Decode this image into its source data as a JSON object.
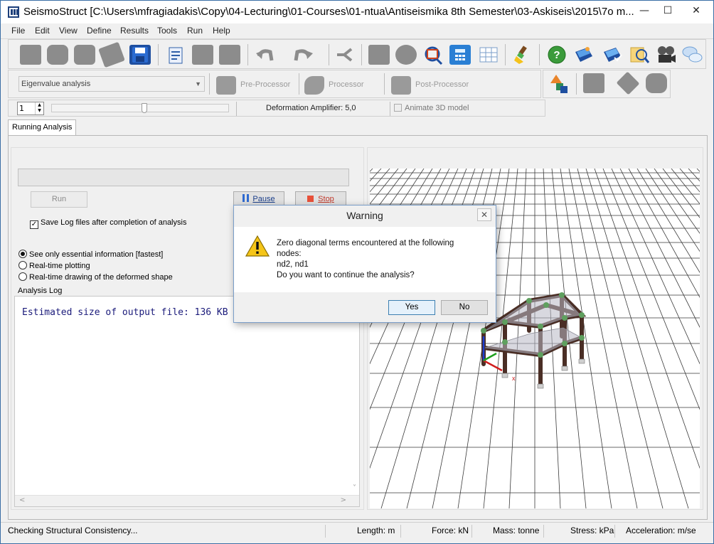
{
  "window": {
    "title": "SeismoStruct   [C:\\Users\\mfragiadakis\\Copy\\04-Lecturing\\01-Courses\\01-ntua\\Antiseismika 8th Semester\\03-Askiseis\\2015\\7o m...",
    "minimize": "—",
    "maximize": "☐",
    "close": "✕"
  },
  "menu": [
    "File",
    "Edit",
    "View",
    "Define",
    "Results",
    "Tools",
    "Run",
    "Help"
  ],
  "toolbar2": {
    "analysis_type": "Eigenvalue analysis",
    "stages": [
      "Pre-Processor",
      "Processor",
      "Post-Processor"
    ]
  },
  "toolbar3": {
    "step_value": "1",
    "deformation_amplifier": "Deformation Amplifier: 5,0",
    "animate_label": "Animate 3D model"
  },
  "tabs": [
    "Running Analysis"
  ],
  "controls": {
    "run": "Run",
    "pause": "Pause",
    "stop": "Stop",
    "save_log": "Save Log files after completion of analysis",
    "radios": [
      "See only essential information [fastest]",
      "Real-time plotting",
      "Real-time drawing of the deformed shape"
    ]
  },
  "log": {
    "label": "Analysis Log",
    "text": "Estimated size of output file: 136 KB"
  },
  "dialog": {
    "title": "Warning",
    "line1": "Zero diagonal terms encountered at the following",
    "line2": "nodes:",
    "line3": "nd2, nd1",
    "line4": "Do you want to continue the analysis?",
    "yes": "Yes",
    "no": "No"
  },
  "status": {
    "message": "Checking Structural Consistency...",
    "length": "Length: m",
    "force": "Force: kN",
    "mass": "Mass: tonne",
    "stress": "Stress: kPa",
    "acceleration": "Acceleration: m/se"
  },
  "axes": {
    "x": "x"
  },
  "colors": {
    "accent": "#3a6ea5",
    "frame": "#5b3a2e",
    "node": "#5fa05f"
  }
}
